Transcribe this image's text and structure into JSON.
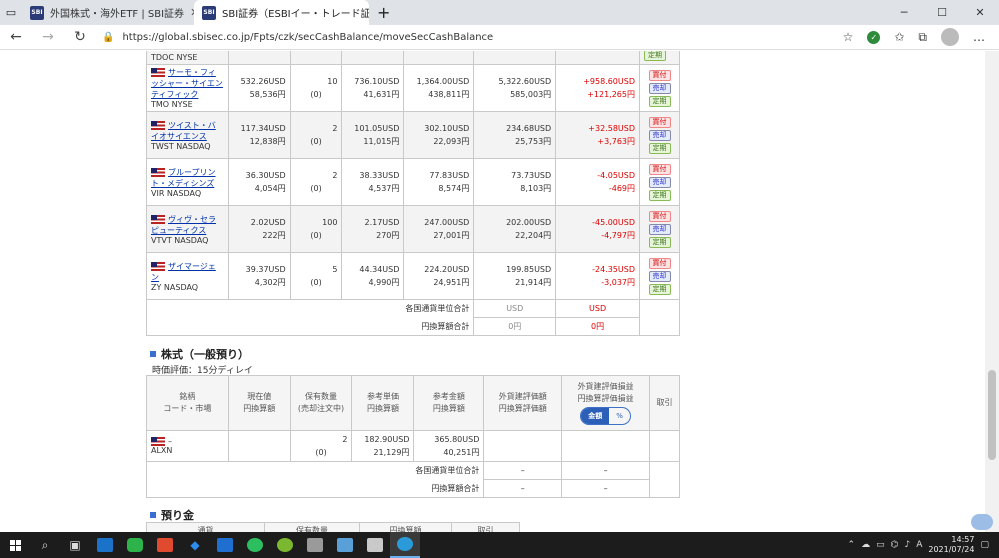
{
  "browser": {
    "tabs": [
      {
        "title": "外国株式・海外ETF | SBI証券",
        "favicon": "SBI"
      },
      {
        "title": "SBI証券（ESBIイー・トレード証券）",
        "favicon": "SBI"
      }
    ],
    "url": "https://global.sbisec.co.jp/Fpts/czk/secCashBalance/moveSecCashBalance"
  },
  "holdings": {
    "partial_top_code": "TDOC NYSE",
    "rows": [
      {
        "name": "サーモ・フィッシャー・サイエンティフィック",
        "code": "TMO NYSE",
        "price_usd": "532.26USD",
        "price_jpy": "58,536円",
        "qty": "10",
        "qty_sub": "(0)",
        "avg_usd": "736.10USD",
        "avg_jpy": "41,631円",
        "amount_usd": "1,364.00USD",
        "amount_jpy": "438,811円",
        "value_usd": "5,322.60USD",
        "value_jpy": "585,003円",
        "pl_usd": "+958.60USD",
        "pl_jpy": "+121,265円"
      },
      {
        "name": "ツイスト・バイオサイエンス",
        "code": "TWST NASDAQ",
        "price_usd": "117.34USD",
        "price_jpy": "12,838円",
        "qty": "2",
        "qty_sub": "(0)",
        "avg_usd": "101.05USD",
        "avg_jpy": "11,015円",
        "amount_usd": "302.10USD",
        "amount_jpy": "22,093円",
        "value_usd": "234.68USD",
        "value_jpy": "25,753円",
        "pl_usd": "+32.58USD",
        "pl_jpy": "+3,763円"
      },
      {
        "name": "ブループリント・メディシンズ",
        "code": "VIR NASDAQ",
        "price_usd": "36.30USD",
        "price_jpy": "4,054円",
        "qty": "2",
        "qty_sub": "(0)",
        "avg_usd": "38.33USD",
        "avg_jpy": "4,537円",
        "amount_usd": "77.83USD",
        "amount_jpy": "8,574円",
        "value_usd": "73.73USD",
        "value_jpy": "8,103円",
        "pl_usd": "-4.05USD",
        "pl_jpy": "-469円"
      },
      {
        "name": "ヴィヴ・セラピューティクス",
        "code": "VTVT NASDAQ",
        "price_usd": "2.02USD",
        "price_jpy": "222円",
        "qty": "100",
        "qty_sub": "(0)",
        "avg_usd": "2.17USD",
        "avg_jpy": "270円",
        "amount_usd": "247.00USD",
        "amount_jpy": "27,001円",
        "value_usd": "202.00USD",
        "value_jpy": "22,204円",
        "pl_usd": "-45.00USD",
        "pl_jpy": "-4,797円"
      },
      {
        "name": "ザイマージェン",
        "code": "ZY NASDAQ",
        "price_usd": "39.37USD",
        "price_jpy": "4,302円",
        "qty": "5",
        "qty_sub": "(0)",
        "avg_usd": "44.34USD",
        "avg_jpy": "4,990円",
        "amount_usd": "224.20USD",
        "amount_jpy": "24,951円",
        "value_usd": "199.85USD",
        "value_jpy": "21,914円",
        "pl_usd": "-24.35USD",
        "pl_jpy": "-3,037円"
      }
    ],
    "buttons": {
      "buy": "買付",
      "sell": "売却",
      "cur": "定期"
    },
    "totals": [
      {
        "label": "各国通貨単位合計",
        "value": "USD",
        "pl": "USD"
      },
      {
        "label": "円換算額合計",
        "value": "0円",
        "pl": "0円"
      }
    ]
  },
  "general": {
    "title": "株式（一般預り）",
    "delay": "時価評価：15分ディレイ",
    "headers": {
      "name": "銘柄\nコード・市場",
      "price": "現在値\n円換算額",
      "qty": "保有数量\n(売却注文中)",
      "avg": "参考単価\n円換算額",
      "amount": "参考金額\n円換算額",
      "value": "外貨建評価額\n円換算評価額",
      "pl": "外貨建評価損益\n円換算評価損益",
      "action": "取引"
    },
    "toggle": {
      "on": "金額",
      "off": "%"
    },
    "row": {
      "name": "–",
      "code": "ALXN",
      "qty": "2",
      "qty_sub": "(0)",
      "avg_usd": "182.90USD",
      "avg_jpy": "21,129円",
      "amount_usd": "365.80USD",
      "amount_jpy": "40,251円"
    },
    "totals": [
      {
        "label": "各国通貨単位合計",
        "value": "–",
        "pl": "–"
      },
      {
        "label": "円換算額合計",
        "value": "–",
        "pl": "–"
      }
    ]
  },
  "deposit": {
    "title": "預り金",
    "headers": [
      "通貨",
      "保有数量",
      "円換算額",
      "取引"
    ]
  },
  "taskbar": {
    "time": "14:57",
    "date": "2021/07/24",
    "lang": "A"
  }
}
